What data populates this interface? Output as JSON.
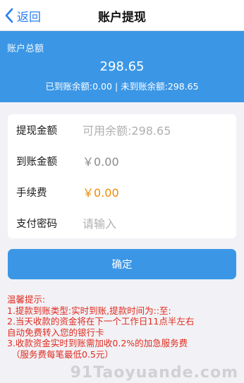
{
  "navbar": {
    "back_label": "返回",
    "title": "账户提现"
  },
  "summary": {
    "label": "账户总额",
    "total": "298.65",
    "detail": "已到账余额:0.00 | 未到账余额:298.65"
  },
  "form": {
    "rows": [
      {
        "label": "提现金额",
        "placeholder": "可用余额:298.65"
      },
      {
        "label": "到账金额",
        "value": "￥0.00"
      },
      {
        "label": "手续费",
        "value": "￥0.00"
      },
      {
        "label": "支付密码",
        "placeholder": "请输入"
      }
    ]
  },
  "confirm_label": "确定",
  "tips": {
    "title": "温馨提示:",
    "lines": [
      "1.提款到账类型:实时到账,提款时间为::至:",
      "2.当天收款的资金将在下一个工作日11点半左右",
      "自动免费转入您的银行卡",
      "3.收款资金实时到账需加收0.2%的加急服务费",
      "（服务费每笔最低0.5元）"
    ]
  },
  "watermark": "91Taoyuande.com",
  "colors": {
    "accent": "#3b97e6",
    "fee": "#f08a00",
    "tips": "#e02b1f"
  }
}
